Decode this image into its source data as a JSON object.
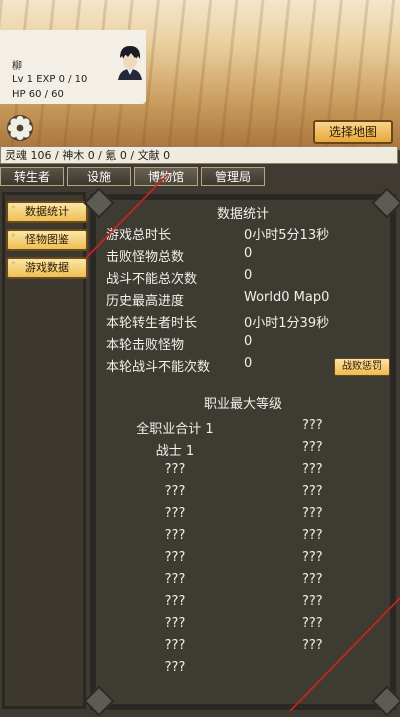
{
  "player": {
    "name": "柳",
    "level_exp": "Lv 1 EXP 0 / 10",
    "hp": "HP 60 / 60"
  },
  "select_map_label": "选择地图",
  "resources": "灵魂 106 / 神木 0 / 氪 0 / 文献 0",
  "tabs": [
    {
      "label": "转生者"
    },
    {
      "label": "设施"
    },
    {
      "label": "博物馆"
    },
    {
      "label": "管理局"
    }
  ],
  "sidebar": [
    {
      "label": "数据统计"
    },
    {
      "label": "怪物图鉴"
    },
    {
      "label": "游戏数据"
    }
  ],
  "stats": {
    "title": "数据统计",
    "rows": [
      {
        "label": "游戏总时长",
        "value": "0小时5分13秒"
      },
      {
        "label": "击败怪物总数",
        "value": "0"
      },
      {
        "label": "战斗不能总次数",
        "value": "0"
      },
      {
        "label": "历史最高进度",
        "value": "World0 Map0"
      },
      {
        "label": "本轮转生者时长",
        "value": "0小时1分39秒"
      },
      {
        "label": "本轮击败怪物",
        "value": "0"
      },
      {
        "label": "本轮战斗不能次数",
        "value": "0"
      }
    ],
    "penalty_button": "战败惩罚"
  },
  "job_levels": {
    "title": "职业最大等级",
    "rows": [
      {
        "name": "全职业合计 1",
        "value": "???"
      },
      {
        "name": "战士 1",
        "value": "???"
      },
      {
        "name": "???",
        "value": "???"
      },
      {
        "name": "???",
        "value": "???"
      },
      {
        "name": "???",
        "value": "???"
      },
      {
        "name": "???",
        "value": "???"
      },
      {
        "name": "???",
        "value": "???"
      },
      {
        "name": "???",
        "value": "???"
      },
      {
        "name": "???",
        "value": "???"
      },
      {
        "name": "???",
        "value": "???"
      },
      {
        "name": "???",
        "value": "???"
      },
      {
        "name": "???",
        "value": ""
      }
    ]
  }
}
